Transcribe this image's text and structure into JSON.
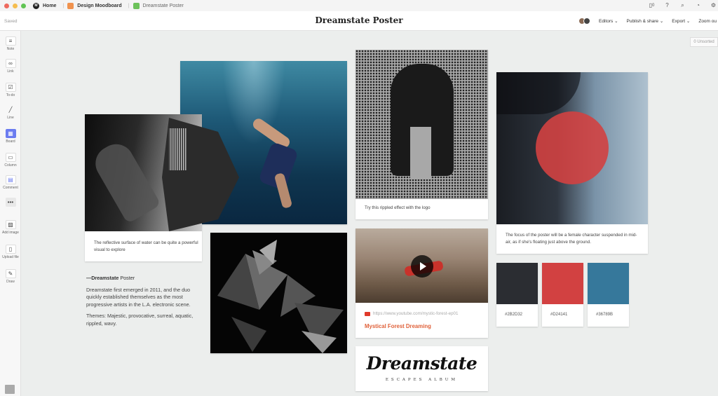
{
  "topbar": {
    "home": "Home",
    "crumbs": [
      "Design Moodboard",
      "Dreamstate Poster"
    ],
    "notification_count": "0"
  },
  "header": {
    "saved": "Saved",
    "title": "Dreamstate Poster",
    "editors": "Editors ⌄",
    "publish": "Publish & share ⌄",
    "export": "Export ⌄",
    "zoom": "Zoom ou"
  },
  "toolbar": {
    "items": [
      {
        "label": "Note",
        "icon": "note-icon"
      },
      {
        "label": "Link",
        "icon": "link-icon"
      },
      {
        "label": "To-do",
        "icon": "todo-icon"
      },
      {
        "label": "Line",
        "icon": "line-icon"
      },
      {
        "label": "Board",
        "icon": "board-icon"
      },
      {
        "label": "Column",
        "icon": "column-icon"
      },
      {
        "label": "Comment",
        "icon": "comment-icon"
      },
      {
        "label": "",
        "icon": "more-icon"
      },
      {
        "label": "Add image",
        "icon": "image-icon"
      },
      {
        "label": "Upload file",
        "icon": "upload-icon"
      },
      {
        "label": "Draw",
        "icon": "pen-icon"
      }
    ]
  },
  "canvas": {
    "unsorted_count": "0",
    "unsorted_label": "Unsorted",
    "hand_caption": "The reflective surface of water can be quite a powerful visual to explore",
    "halftone_caption": "Try this rippled effect with the logo",
    "portrait_caption": "The focus of the poster will be a female character suspended in mid-air, as if  she's floating just above the ground.",
    "note_heading_bold": "—Dreamstate",
    "note_heading_rest": " Poster",
    "note_p1": "Dreamstate first emerged in 2011, and the duo quickly established themselves as the most progressive artists in the L.A. electronic scene.",
    "note_p2": "Themes: Majestic, provocative, surreal, aquatic, rippled, wavy.",
    "video_url": "https://www.youtube.com/mystic-forest-ep01",
    "video_title": "Mystical Forest Dreaming",
    "logo_main": "Dreamstate",
    "logo_sub": "ESCAPES ALBUM",
    "swatches": [
      {
        "hex": "#2B2D32",
        "color": "#2B2D32"
      },
      {
        "hex": "#D24141",
        "color": "#D24141"
      },
      {
        "hex": "#36789B",
        "color": "#36789B"
      }
    ]
  }
}
